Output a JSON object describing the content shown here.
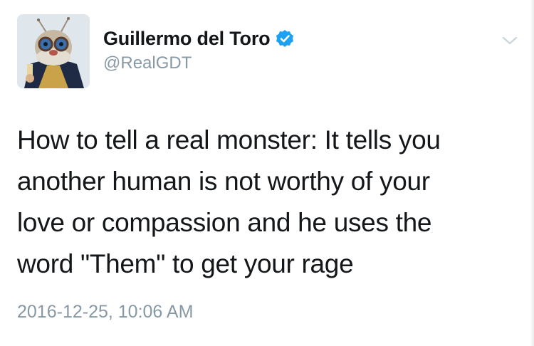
{
  "tweet": {
    "author": {
      "display_name": "Guillermo del Toro",
      "handle": "@RealGDT",
      "verified": true,
      "avatar_icon": "profile-avatar-creature",
      "verified_icon": "verified-badge-icon"
    },
    "text": "How to tell a real monster: It tells you\nanother human is not worthy of your\nlove or compassion and he uses the\nword \"Them\" to get your rage",
    "timestamp": "2016-12-25, 10:06 AM",
    "menu_icon": "chevron-down-icon"
  },
  "colors": {
    "verified_blue": "#1da1f2",
    "secondary_text": "#8899a6",
    "primary_text": "#14171a"
  }
}
